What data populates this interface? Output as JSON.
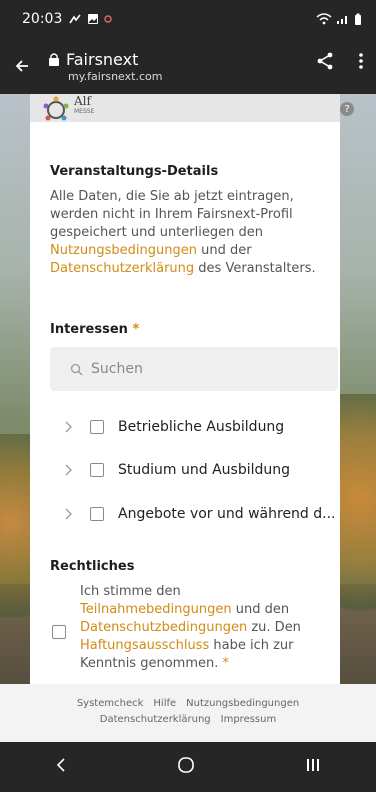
{
  "status_bar": {
    "time": "20:03"
  },
  "browser": {
    "title": "Fairsnext",
    "url": "my.fairsnext.com"
  },
  "logo": {
    "text": "Alf",
    "sub": "MESSE"
  },
  "details": {
    "heading": "Veranstaltungs-Details",
    "line1": "Alle Daten, die Sie ab jetzt eintragen,",
    "line2": "werden nicht in Ihrem Fairsnext-Profil",
    "line3": "gespeichert und unterliegen den",
    "link1": "Nutzungsbedingungen",
    "text_and": " und der",
    "link2": "Datenschutzerklärung",
    "text_end": " des Veranstalters."
  },
  "interests": {
    "heading": "Interessen",
    "required_mark": "*",
    "search_placeholder": "Suchen",
    "items": [
      {
        "label": "Betriebliche Ausbildung"
      },
      {
        "label": "Studium und Ausbildung"
      },
      {
        "label": "Angebote vor und während d..."
      }
    ]
  },
  "legal": {
    "heading": "Rechtliches",
    "line1": "Ich stimme den",
    "link1": "Teilnahmebedingungen",
    "text_and": " und den",
    "link2": "Datenschutzbedingungen",
    "text_mid": " zu. Den",
    "link3": "Haftungsausschluss",
    "text_after": " habe ich zur",
    "line_last": "Kenntnis genommen.",
    "required_mark": "*"
  },
  "footer": {
    "links_row1": [
      "Systemcheck",
      "Hilfe",
      "Nutzungsbedingungen"
    ],
    "links_row2": [
      "Datenschutzerklärung",
      "Impressum"
    ]
  },
  "colors": {
    "accent": "#d28b16",
    "bar": "#262626"
  }
}
